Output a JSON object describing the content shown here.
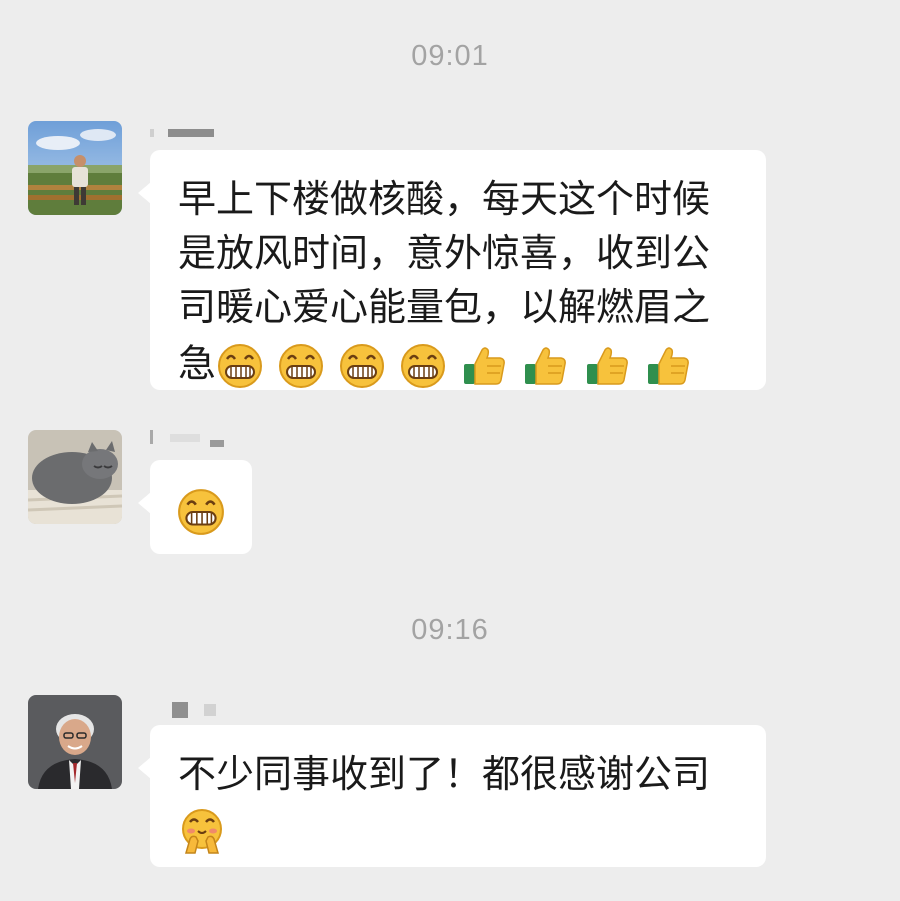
{
  "timestamps": {
    "first": "09:01",
    "second": "09:16"
  },
  "messages": [
    {
      "text": "早上下楼做核酸，每天这个时候是放风时间，意外惊喜，收到公司暖心爱心能量包，以解燃眉之急",
      "lines": [
        "早上下楼做核酸，每天这个时候",
        "是放风时间，意外惊喜，收到公",
        "司暖心爱心能量包，以解燃眉之",
        "急"
      ],
      "emojis": [
        "grin-icon",
        "grin-icon",
        "grin-icon",
        "grin-icon",
        "thumbs-up-icon",
        "thumbs-up-icon",
        "thumbs-up-icon",
        "thumbs-up-icon"
      ]
    },
    {
      "text": "",
      "emojis": [
        "grin-icon"
      ]
    },
    {
      "text": "不少同事收到了！都很感谢公司",
      "emojis": [
        "fist-pump-icon"
      ]
    }
  ],
  "colors": {
    "background": "#ededed",
    "bubble": "#ffffff",
    "timestamp": "#a3a3a3",
    "text": "#1a1a1a"
  }
}
